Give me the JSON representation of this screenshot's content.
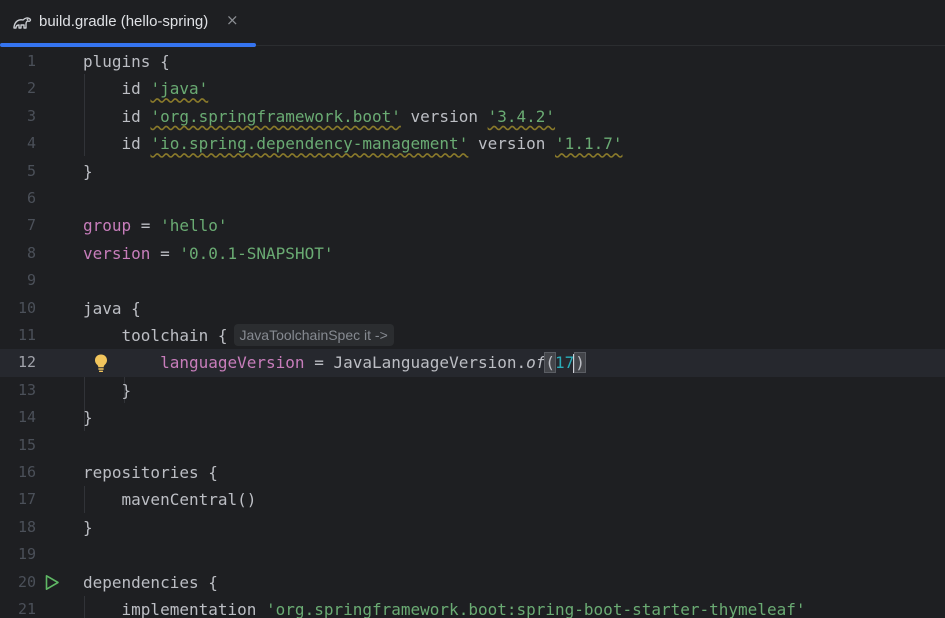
{
  "tab": {
    "title": "build.gradle (hello-spring)",
    "close_glyph": "×",
    "icon": "gradle-elephant-icon"
  },
  "editor": {
    "current_line": 12,
    "lines": [
      {
        "n": "1"
      },
      {
        "n": "2"
      },
      {
        "n": "3"
      },
      {
        "n": "4"
      },
      {
        "n": "5"
      },
      {
        "n": "6"
      },
      {
        "n": "7"
      },
      {
        "n": "8"
      },
      {
        "n": "9"
      },
      {
        "n": "10"
      },
      {
        "n": "11"
      },
      {
        "n": "12"
      },
      {
        "n": "13"
      },
      {
        "n": "14"
      },
      {
        "n": "15"
      },
      {
        "n": "16"
      },
      {
        "n": "17"
      },
      {
        "n": "18"
      },
      {
        "n": "19"
      },
      {
        "n": "20"
      },
      {
        "n": "21"
      }
    ],
    "tokens": {
      "plugins": "plugins {",
      "id": "id",
      "java_str": "'java'",
      "spring_boot_str": "'org.springframework.boot'",
      "version_kw": "version",
      "spring_boot_ver": "'3.4.2'",
      "dep_mgmt_str": "'io.spring.dependency-management'",
      "dep_mgmt_ver": "'1.1.7'",
      "close_brace": "}",
      "group_kw": "group",
      "eq": " = ",
      "group_val": "'hello'",
      "version_prop": "version",
      "version_val": "'0.0.1-SNAPSHOT'",
      "java_block": "java {",
      "toolchain": "toolchain {",
      "toolchain_hint": "JavaToolchainSpec it ->",
      "lang_version_prop": "languageVersion",
      "lang_version_cls": "JavaLanguageVersion.",
      "of_fn": "of",
      "open_paren": "(",
      "java_ver_num": "17",
      "close_paren": ")",
      "repositories": "repositories {",
      "maven_central": "mavenCentral()",
      "dependencies": "dependencies {",
      "implementation": "implementation ",
      "thymeleaf_str": "'org.springframework.boot:spring-boot-starter-thymeleaf'"
    }
  },
  "colors": {
    "background": "#1e1f22",
    "tab_accent": "#3574f0",
    "string": "#6aab73",
    "property": "#c77dbb",
    "number": "#2aacb8",
    "run_icon": "#5fb865",
    "bulb": "#f2c55c"
  }
}
